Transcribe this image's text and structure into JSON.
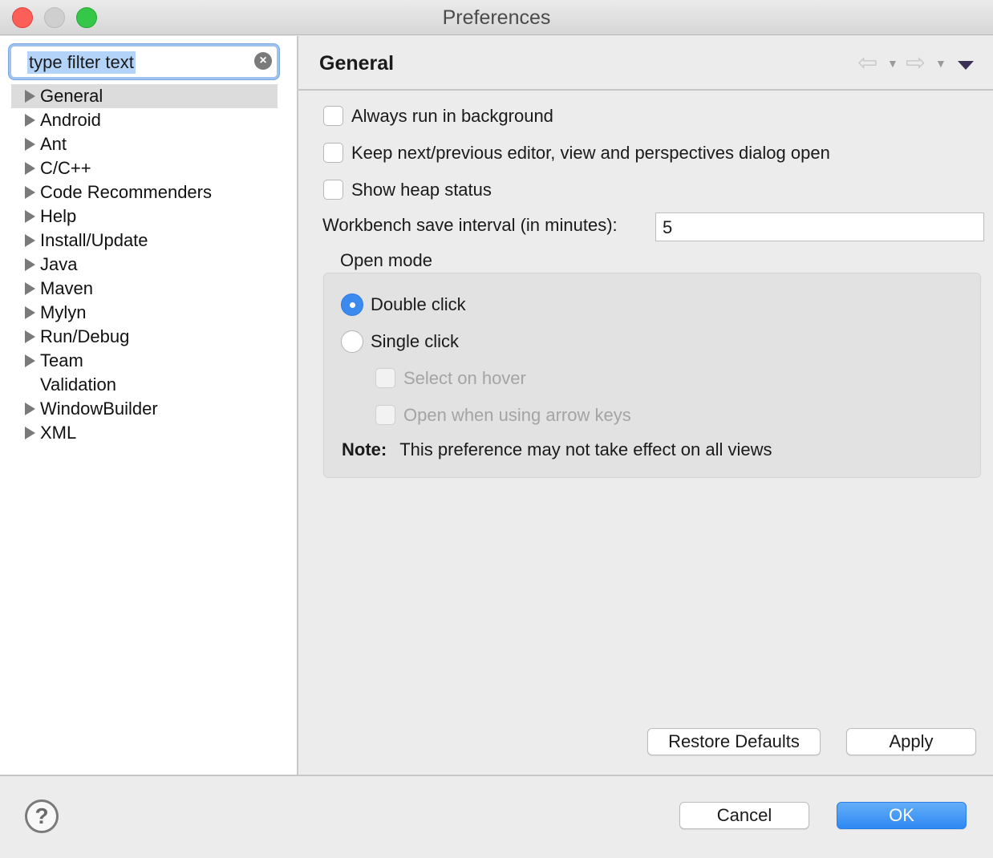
{
  "window": {
    "title": "Preferences"
  },
  "filter": {
    "value": "type filter text"
  },
  "tree": {
    "items": [
      {
        "label": "General",
        "expandable": true,
        "selected": true
      },
      {
        "label": "Android",
        "expandable": true
      },
      {
        "label": "Ant",
        "expandable": true
      },
      {
        "label": "C/C++",
        "expandable": true
      },
      {
        "label": "Code Recommenders",
        "expandable": true
      },
      {
        "label": "Help",
        "expandable": true
      },
      {
        "label": "Install/Update",
        "expandable": true
      },
      {
        "label": "Java",
        "expandable": true
      },
      {
        "label": "Maven",
        "expandable": true
      },
      {
        "label": "Mylyn",
        "expandable": true
      },
      {
        "label": "Run/Debug",
        "expandable": true
      },
      {
        "label": "Team",
        "expandable": true
      },
      {
        "label": "Validation",
        "expandable": false
      },
      {
        "label": "WindowBuilder",
        "expandable": true
      },
      {
        "label": "XML",
        "expandable": true
      }
    ]
  },
  "page": {
    "title": "General",
    "options": {
      "always_run_background": "Always run in background",
      "keep_dialog_open": "Keep next/previous editor, view and perspectives dialog open",
      "show_heap": "Show heap status"
    },
    "save_interval": {
      "label": "Workbench save interval (in minutes):",
      "value": "5"
    },
    "open_mode": {
      "label": "Open mode",
      "double_click": "Double click",
      "single_click": "Single click",
      "selected": "double_click",
      "select_on_hover": "Select on hover",
      "open_arrow_keys": "Open when using arrow keys",
      "note_label": "Note:",
      "note_text": "This preference may not take effect on all views"
    },
    "restore_defaults": "Restore Defaults",
    "apply": "Apply"
  },
  "footer": {
    "cancel": "Cancel",
    "ok": "OK"
  },
  "colors": {
    "accent": "#3b8af0",
    "selection": "#dcdcdc"
  }
}
